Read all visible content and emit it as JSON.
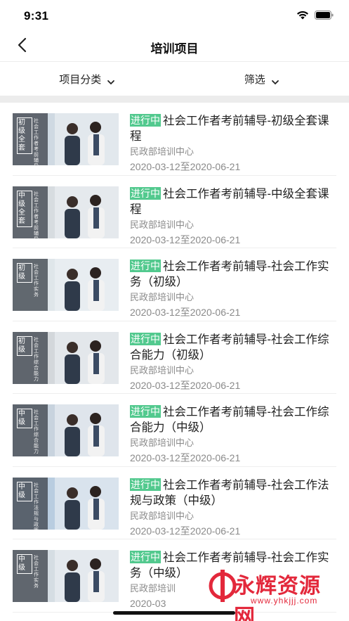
{
  "status_bar": {
    "time": "9:31"
  },
  "nav": {
    "title": "培训项目"
  },
  "filters": {
    "category_label": "项目分类",
    "filter_label": "筛选"
  },
  "courses": [
    {
      "badge": "进行中",
      "title": "社会工作者考前辅导-初级全套课程",
      "org": "民政部培训中心",
      "date": "2020-03-12至2020-06-21",
      "thumb_level": "初级全套",
      "thumb_sub": "社会工作者考前辅导",
      "thumb_color": "#cfd9e2"
    },
    {
      "badge": "进行中",
      "title": "社会工作者考前辅导-中级全套课程",
      "org": "民政部培训中心",
      "date": "2020-03-12至2020-06-21",
      "thumb_level": "中级全套",
      "thumb_sub": "社会工作者考前辅导",
      "thumb_color": "#d7dce0"
    },
    {
      "badge": "进行中",
      "title": "社会工作者考前辅导-社会工作实务（初级）",
      "org": "民政部培训中心",
      "date": "2020-03-12至2020-06-21",
      "thumb_level": "初级",
      "thumb_sub": "社会工作实务",
      "thumb_color": "#dfe6ea"
    },
    {
      "badge": "进行中",
      "title": "社会工作者考前辅导-社会工作综合能力（初级）",
      "org": "民政部培训中心",
      "date": "2020-03-12至2020-06-21",
      "thumb_level": "初级",
      "thumb_sub": "社会工作综合能力",
      "thumb_color": "#d3d7db"
    },
    {
      "badge": "进行中",
      "title": "社会工作者考前辅导-社会工作综合能力（中级）",
      "org": "民政部培训中心",
      "date": "2020-03-12至2020-06-21",
      "thumb_level": "中级",
      "thumb_sub": "社会工作综合能力",
      "thumb_color": "#c8d3de"
    },
    {
      "badge": "进行中",
      "title": "社会工作者考前辅导-社会工作法规与政策（中级）",
      "org": "民政部培训中心",
      "date": "2020-03-12至2020-06-21",
      "thumb_level": "中级",
      "thumb_sub": "社会工作法规与政策",
      "thumb_color": "#b9cde0"
    },
    {
      "badge": "进行中",
      "title": "社会工作者考前辅导-社会工作实务（中级）",
      "org": "民政部培训",
      "date": "2020-03",
      "thumb_level": "中级",
      "thumb_sub": "社会工作实务",
      "thumb_color": "#d5dde3"
    }
  ],
  "watermark": {
    "text": "永辉资源网",
    "url": "www.yhkjjj.com"
  },
  "colors": {
    "badge_green": "#52c98e",
    "separator_gray": "#ececec",
    "watermark_red": "#e3283b"
  }
}
